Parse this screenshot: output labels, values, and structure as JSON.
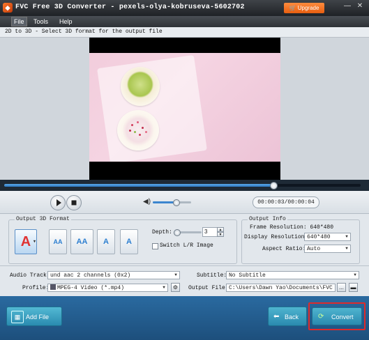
{
  "window": {
    "title": "FVC Free 3D Converter - pexels-olya-kobruseva-5602702",
    "upgrade_label": "Upgrade",
    "minimize_icon": "minimize-icon",
    "close_icon": "close-icon"
  },
  "menu": {
    "items": [
      {
        "label": "File"
      },
      {
        "label": "Tools"
      },
      {
        "label": "Help"
      }
    ]
  },
  "hint": "2D to 3D - Select 3D format for the output file",
  "player": {
    "progress_fraction": 0.755,
    "volume_fraction": 0.6,
    "time": "00:00:03/00:00:04"
  },
  "output_format": {
    "label": "Output 3D Format",
    "formats": [
      {
        "icon": "anaglyph-icon",
        "glyph": "A"
      },
      {
        "icon": "side-by-side-half-icon",
        "glyph": "AA"
      },
      {
        "icon": "side-by-side-full-icon",
        "glyph": "AA"
      },
      {
        "icon": "top-bottom-half-icon",
        "glyph": "A"
      },
      {
        "icon": "top-bottom-full-icon",
        "glyph": "A"
      }
    ],
    "depth_label": "Depth:",
    "depth_value": "3",
    "depth_fraction": 0.05,
    "switch_label": "Switch L/R Image"
  },
  "output_info": {
    "label": "Output Info",
    "frame_resolution": "Frame Resolution: 640*480",
    "display_resolution_label": "Display Resolution:",
    "display_resolution_value": "640*480",
    "aspect_ratio_label": "Aspect Ratio:",
    "aspect_ratio_value": "Auto"
  },
  "tracks": {
    "audio_label": "Audio Track:",
    "audio_value": "und aac 2 channels (0x2)",
    "subtitle_label": "Subtitle:",
    "subtitle_value": "No Subtitle",
    "profile_label": "Profile:",
    "profile_value": "MPEG-4 Video (*.mp4)",
    "output_file_label": "Output File:",
    "output_file_value": "C:\\Users\\Dawn Yao\\Documents\\FVC Stu",
    "browse_label": "...",
    "folder_icon": "folder-icon",
    "settings_icon": "gear-icon"
  },
  "bottom": {
    "add_file_label": "Add File",
    "back_label": "Back",
    "convert_label": "Convert"
  }
}
